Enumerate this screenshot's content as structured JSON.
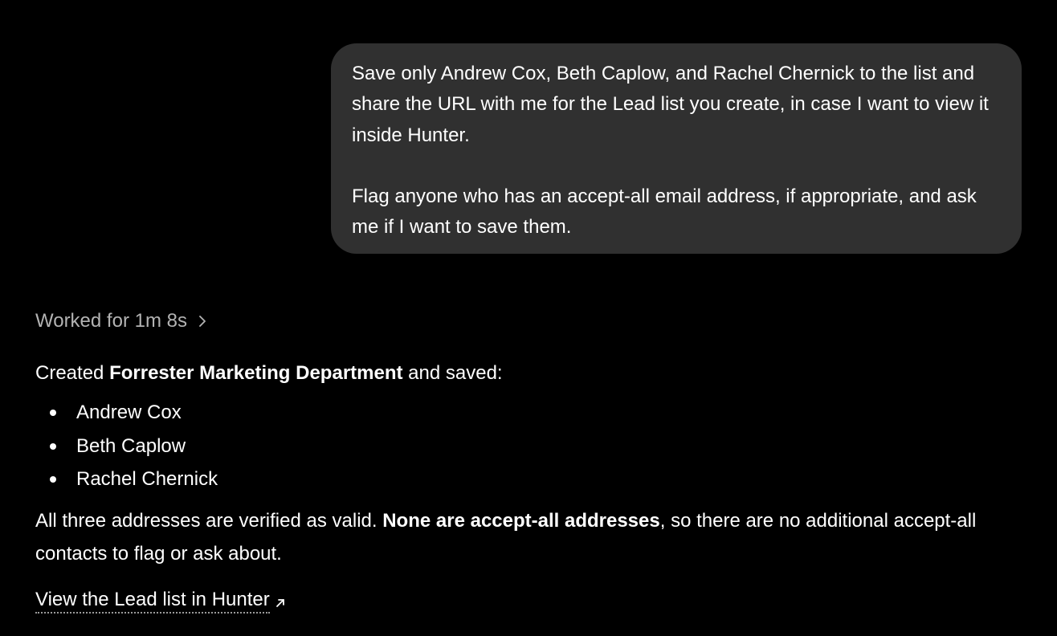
{
  "user_message": {
    "paragraph1": "Save only Andrew Cox, Beth Caplow, and Rachel Chernick to the list and share the URL with me for the Lead list you create, in case I want to view it inside Hunter.",
    "paragraph2": "Flag anyone who has an accept-all email address, if appropriate, and ask me if I want to save them."
  },
  "worked": {
    "label": "Worked for 1m 8s",
    "icon": "chevron-right-icon"
  },
  "assistant": {
    "created_prefix": "Created ",
    "list_name": "Forrester Marketing Department",
    "created_suffix": " and saved:",
    "saved_names": [
      "Andrew Cox",
      "Beth Caplow",
      "Rachel Chernick"
    ],
    "summary_prefix": "All three addresses are verified as valid. ",
    "summary_bold": "None are accept-all addresses",
    "summary_suffix": ", so there are no additional accept-all contacts to flag or ask about.",
    "link_label": "View the Lead list in Hunter",
    "link_icon": "external-link-arrow-icon"
  },
  "colors": {
    "background": "#000000",
    "bubble": "#303030",
    "muted_text": "#b3b3b3",
    "text": "#ffffff"
  }
}
